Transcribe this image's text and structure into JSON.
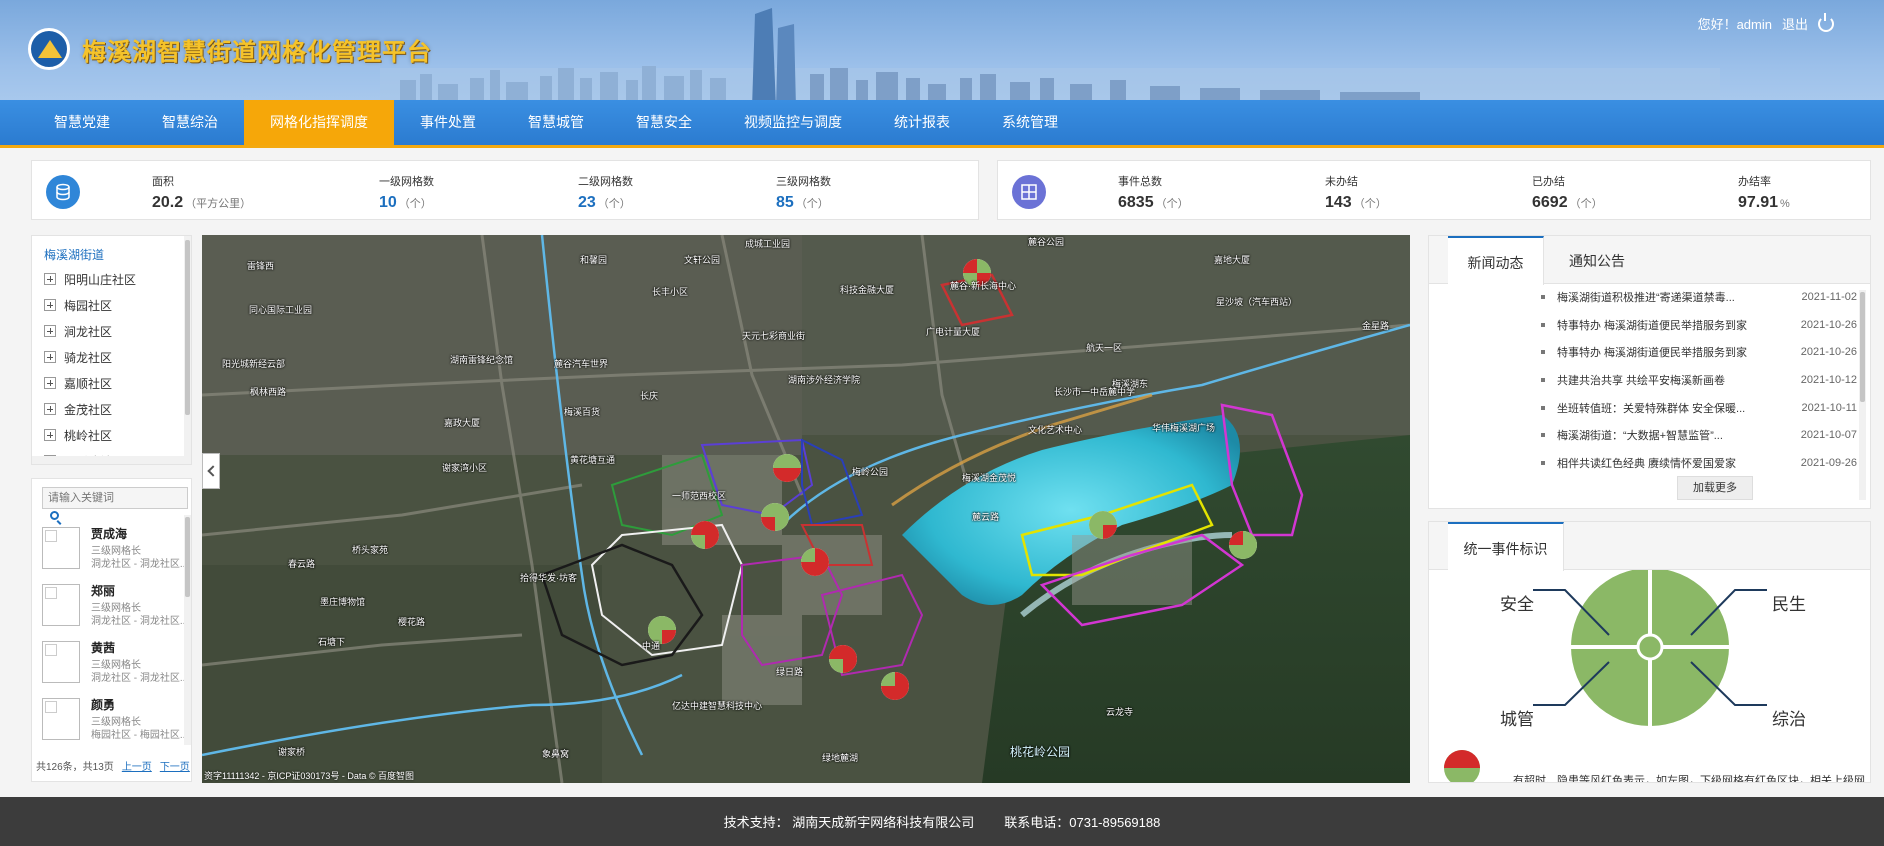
{
  "header": {
    "title": "梅溪湖智慧街道网格化管理平台",
    "greeting": "您好！admin",
    "logout": "退出"
  },
  "nav": {
    "items": [
      "智慧党建",
      "智慧综治",
      "网格化指挥调度",
      "事件处置",
      "智慧城管",
      "智慧安全",
      "视频监控与调度",
      "统计报表",
      "系统管理"
    ],
    "active": "网格化指挥调度"
  },
  "stats_left": {
    "area_label": "面积",
    "area_value": "20.2",
    "area_unit": "（平方公里）",
    "g1_label": "一级网格数",
    "g1_value": "10",
    "g1_unit": "（个）",
    "g2_label": "二级网格数",
    "g2_value": "23",
    "g2_unit": "（个）",
    "g3_label": "三级网格数",
    "g3_value": "85",
    "g3_unit": "（个）"
  },
  "stats_right": {
    "total_label": "事件总数",
    "total_value": "6835",
    "total_unit": "（个）",
    "pending_label": "未办结",
    "pending_value": "143",
    "pending_unit": "（个）",
    "done_label": "已办结",
    "done_value": "6692",
    "done_unit": "（个）",
    "rate_label": "办结率",
    "rate_value": "97.91",
    "rate_unit": "%"
  },
  "tree": {
    "root": "梅溪湖街道",
    "nodes": [
      "阳明山庄社区",
      "梅园社区",
      "涧龙社区",
      "骑龙社区",
      "嘉顺社区",
      "金茂社区",
      "桃岭社区",
      "云溪湾社区"
    ]
  },
  "people": {
    "search_placeholder": "请输入关键词",
    "list": [
      {
        "name": "贾成海",
        "role": "三级网格长",
        "area": "洞龙社区 - 洞龙社区..."
      },
      {
        "name": "郑丽",
        "role": "三级网格长",
        "area": "洞龙社区 - 洞龙社区..."
      },
      {
        "name": "黄茜",
        "role": "三级网格长",
        "area": "洞龙社区 - 洞龙社区..."
      },
      {
        "name": "颜勇",
        "role": "三级网格长",
        "area": "梅园社区 - 梅园社区..."
      }
    ],
    "pager_info": "共126条，共13页",
    "prev": "上一页",
    "next": "下一页"
  },
  "map": {
    "labels": [
      "雷锋西",
      "和馨园",
      "文轩公园",
      "成城工业园",
      "麓谷公园",
      "嘉地大厦",
      "同心国际工业园",
      "长丰小区",
      "科技金融大厦",
      "麓谷·新长海中心",
      "星沙坡（汽车西站）",
      "金星路",
      "阳光城新经云部",
      "湖南雷锋纪念馆",
      "天元七彩商业街",
      "广电计量大厦",
      "麓谷汽车世界",
      "湖南涉外经济学院",
      "航天一区",
      "枫林西路",
      "长庆",
      "梅溪湖东",
      "长沙市一中岳麓中学",
      "嘉政大厦",
      "梅溪百货",
      "文化艺术中心",
      "华伟梅溪湖广场",
      "谢家湾小区",
      "黄花塘互通",
      "梅岭公园",
      "梅溪湖金茂悦",
      "一师范西校区",
      "麓云路",
      "桥头家苑",
      "拾得华发·坊客",
      "春云路",
      "墨庄博物馆",
      "樱花路",
      "石塘下",
      "中通",
      "绿日路",
      "亿达中建智慧科技中心",
      "谢家桥",
      "象鼻窝",
      "绿地麓湖",
      "云龙寺",
      "桃花岭公园"
    ],
    "copyright": "资字11111342 - 京ICP证030173号 - Data © 百度智图"
  },
  "news": {
    "tab_news": "新闻动态",
    "tab_notice": "通知公告",
    "items": [
      {
        "title": "梅溪湖街道积极推进“寄递渠道禁毒...",
        "date": "2021-11-02"
      },
      {
        "title": "特事特办 梅溪湖街道便民举措服务到家",
        "date": "2021-10-26"
      },
      {
        "title": "特事特办 梅溪湖街道便民举措服务到家",
        "date": "2021-10-26"
      },
      {
        "title": "共建共治共享 共绘平安梅溪新画卷",
        "date": "2021-10-12"
      },
      {
        "title": "坐班转值班：关爱特殊群体 安全保暖...",
        "date": "2021-10-11"
      },
      {
        "title": "梅溪湖街道：“大数据+智慧监管”...",
        "date": "2021-10-07"
      },
      {
        "title": "相伴共读红色经典 赓续情怀爱国爱家",
        "date": "2021-09-26"
      }
    ],
    "load_more": "加载更多"
  },
  "event_legend": {
    "title": "统一事件标识",
    "labels": {
      "top_left": "安全",
      "top_right": "民生",
      "bottom_left": "城管",
      "bottom_right": "综治"
    },
    "note": "有超时、隐患等风红色表示，如左图，下级网格有红色区块，相关上级网",
    "colors": {
      "normal": "#8bb866",
      "alert": "#d32a2a"
    }
  },
  "footer": {
    "support": "技术支持： 湖南天成新宇网络科技有限公司",
    "phone": "联系电话：0731-89569188"
  },
  "colors": {
    "nav_active": "#f6a709",
    "nav_bg": "#2b7bd0",
    "title_gold": "#f5c32a",
    "link_blue": "#1c6fbf"
  }
}
